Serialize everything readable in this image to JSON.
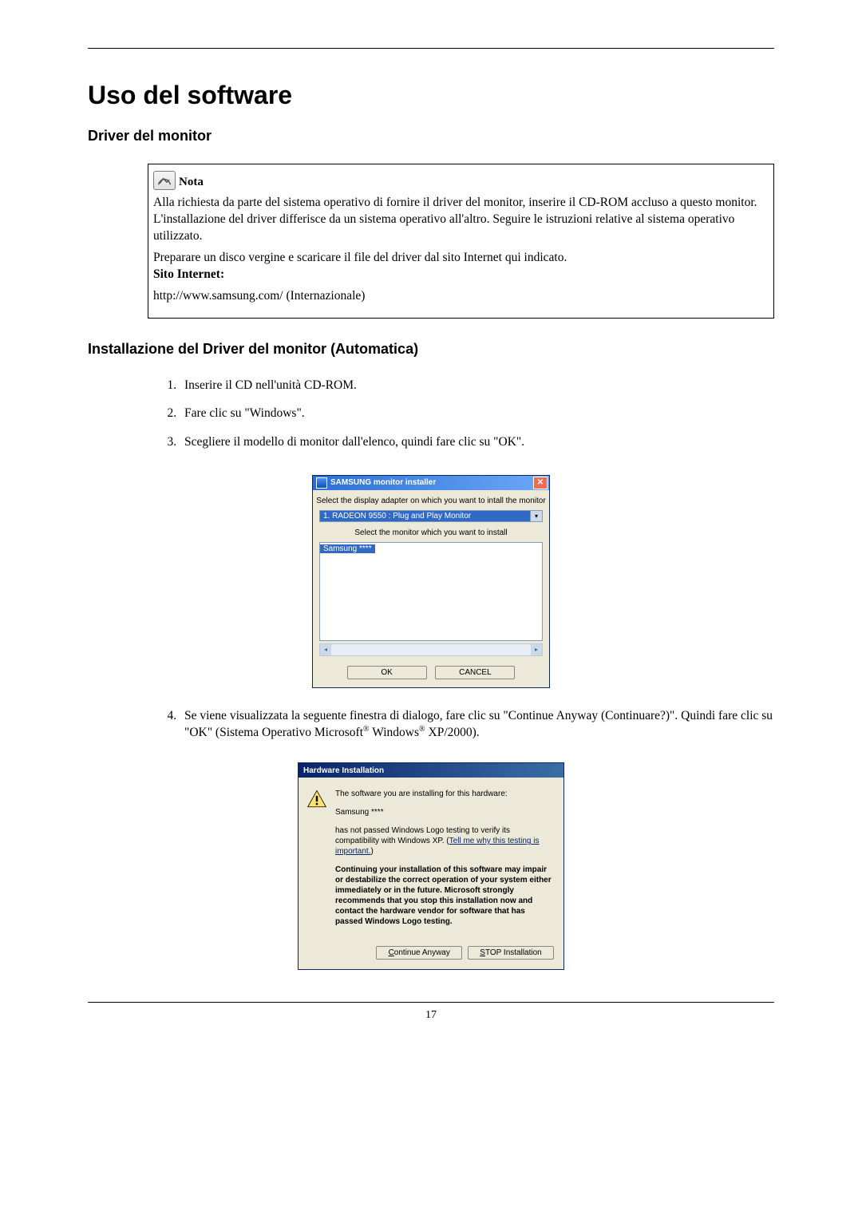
{
  "heading": "Uso del software",
  "section1_title": "Driver del monitor",
  "note": {
    "label": "Nota",
    "p1": "Alla richiesta da parte del sistema operativo di fornire il driver del monitor, inserire il CD-ROM accluso a questo monitor. L'installazione del driver differisce da un sistema operativo all'altro. Seguire le istruzioni relative al sistema operativo utilizzato.",
    "p2": "Preparare un disco vergine e scaricare il file del driver dal sito Internet qui indicato.",
    "label2": "Sito Internet:",
    "url": "http://www.samsung.com/ (Internazionale)"
  },
  "section2_title": "Installazione del Driver del monitor (Automatica)",
  "steps": {
    "s1": "Inserire il CD nell'unità CD-ROM.",
    "s2": "Fare clic su \"Windows\".",
    "s3": "Scegliere il modello di monitor dall'elenco, quindi fare clic su \"OK\".",
    "s4a": "Se viene visualizzata la seguente finestra di dialogo, fare clic su \"Continue Anyway (Continuare?)\". Quindi fare clic su \"OK\" (Sistema Operativo Microsoft",
    "s4b": " Windows",
    "s4c": " XP/2000)."
  },
  "samsung_dialog": {
    "title": "SAMSUNG monitor installer",
    "prompt1": "Select the display adapter on which you want to intall the monitor",
    "combo_selected": "1. RADEON 9550 : Plug and Play Monitor",
    "prompt2": "Select the monitor which you want to install",
    "list_selected": "Samsung ****",
    "btn_ok": "OK",
    "btn_cancel": "CANCEL"
  },
  "hw_dialog": {
    "title": "Hardware Installation",
    "line1": "The software you are installing for this hardware:",
    "line2": "Samsung ****",
    "line3a": "has not passed Windows Logo testing to verify its compatibility with Windows XP. (",
    "link": "Tell me why this testing is important.",
    "line3b": ")",
    "bold": "Continuing your installation of this software may impair or destabilize the correct operation of your system either immediately or in the future. Microsoft strongly recommends that you stop this installation now and contact the hardware vendor for software that has passed Windows Logo testing.",
    "btn_continue_pre": "C",
    "btn_continue_post": "ontinue Anyway",
    "btn_stop_pre": "S",
    "btn_stop_post": "TOP Installation"
  },
  "page_number": "17"
}
